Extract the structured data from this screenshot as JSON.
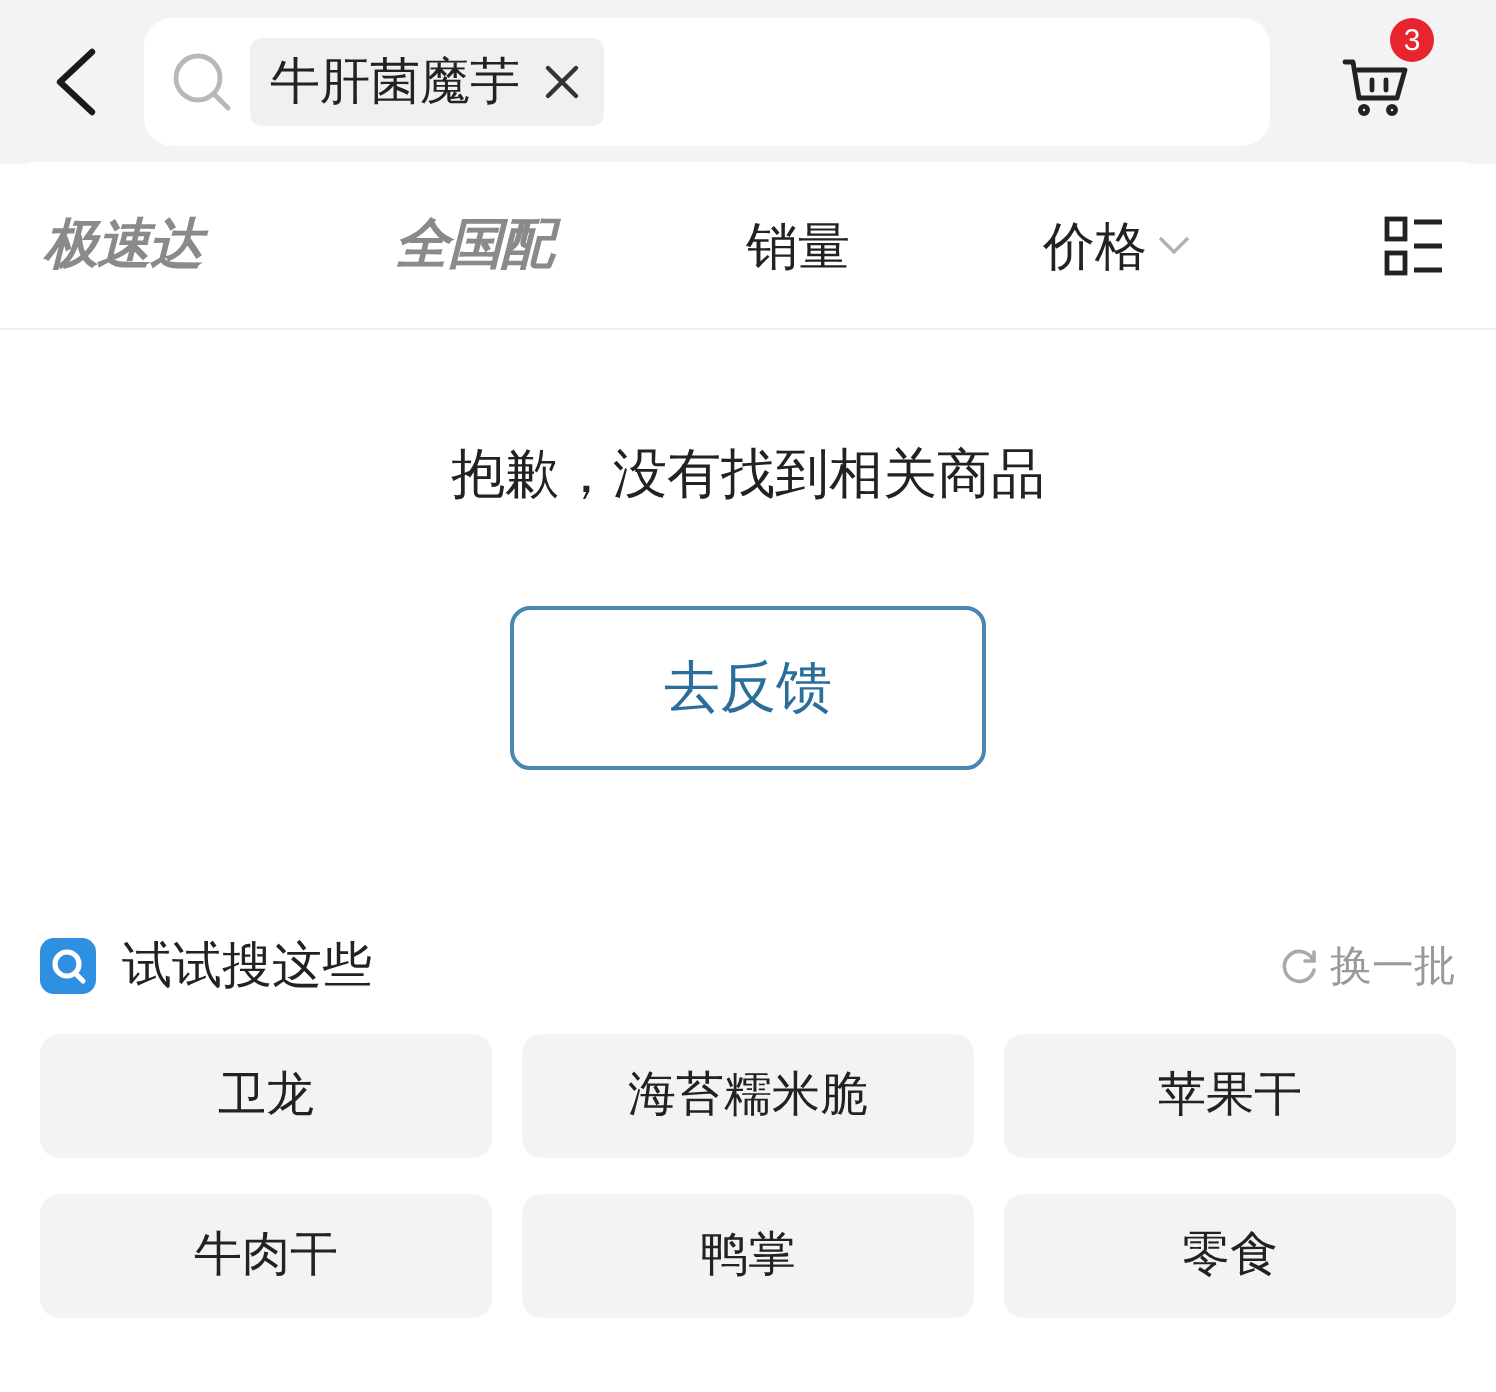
{
  "header": {
    "search": {
      "keyword_chip": "牛肝菌魔芋"
    },
    "cart": {
      "badge": "3"
    }
  },
  "filters": [
    {
      "label": "极速达",
      "kind": "logo"
    },
    {
      "label": "全国配",
      "kind": "logo"
    },
    {
      "label": "销量",
      "kind": "plain"
    },
    {
      "label": "价格",
      "kind": "dropdown"
    }
  ],
  "empty_state": {
    "message": "抱歉，没有找到相关商品",
    "button": "去反馈"
  },
  "suggestions": {
    "title": "试试搜这些",
    "refresh": "换一批",
    "items": [
      "卫龙",
      "海苔糯米脆",
      "苹果干",
      "牛肉干",
      "鸭掌",
      "零食"
    ]
  }
}
